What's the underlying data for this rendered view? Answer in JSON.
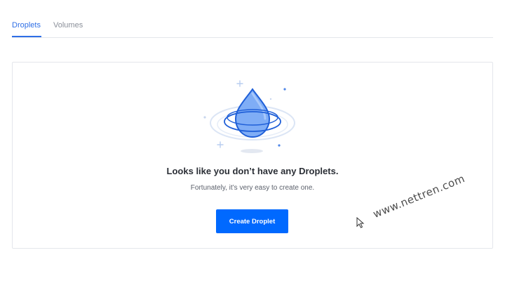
{
  "tabs": [
    {
      "label": "Droplets",
      "active": true
    },
    {
      "label": "Volumes",
      "active": false
    }
  ],
  "empty_state": {
    "illustration_icon": "water-droplet-icon",
    "heading": "Looks like you don’t have any Droplets.",
    "subtext": "Fortunately, it’s very easy to create one.",
    "create_button_label": "Create Droplet"
  },
  "watermark": "www.nettren.com",
  "colors": {
    "accent": "#0069ff",
    "active_tab": "#2f6fe6",
    "inactive_tab": "#8a8f99",
    "heading": "#2b2f36",
    "border": "#e4e6eb"
  }
}
